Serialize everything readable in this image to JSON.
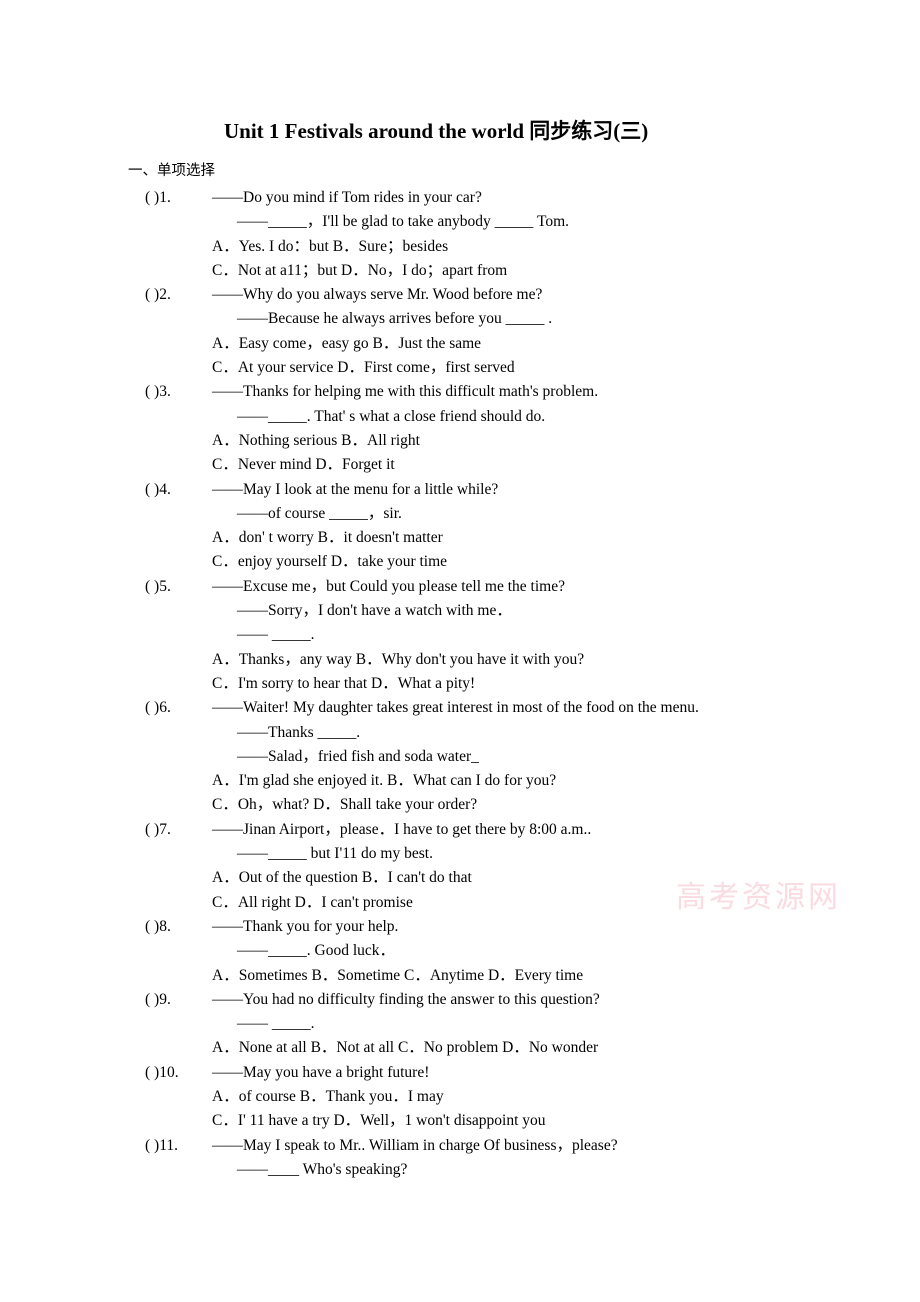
{
  "document": {
    "title": "Unit 1 Festivals around the world  同步练习(三)",
    "section_heading": "一、单项选择",
    "watermark": "高考资源网"
  },
  "questions": [
    {
      "marker": "(        )1.",
      "lines": [
        "——Do you mind if Tom rides in your car?",
        "——_____，I'll be glad to take anybody _____ Tom."
      ],
      "options": [
        "A．Yes. I do：but       B．Sure；besides",
        "C．Not at a11；but      D．No，I do；apart from"
      ]
    },
    {
      "marker": "(        )2.",
      "lines": [
        "——Why do you always serve Mr. Wood before me?",
        "——Because he always arrives before you _____ ."
      ],
      "options": [
        "A．Easy come，easy go      B．Just the same",
        "C．At your service     D．First come，first served"
      ]
    },
    {
      "marker": "(        )3.",
      "lines": [
        "——Thanks for helping me with this difficult math's problem.",
        "——_____. That' s what a close friend should do."
      ],
      "options": [
        "A．Nothing serious      B．All right",
        "C．Never mind     D．Forget it"
      ]
    },
    {
      "marker": "(        )4.",
      "lines": [
        "——May I look at the menu for a little while?",
        "——of course _____，sir."
      ],
      "options": [
        "A．don' t worry      B．it doesn't matter",
        "C．enjoy yourself     D．take your time"
      ]
    },
    {
      "marker": "(        )5.",
      "lines": [
        "——Excuse me，but Could you please tell me the time?",
        "——Sorry，I don't have a watch with me．",
        "—— _____."
      ],
      "options": [
        "A．Thanks，any way      B．Why don't you have it with you?",
        "C．I'm sorry to hear that     D．What a pity!"
      ]
    },
    {
      "marker": "(        )6.",
      "lines": [
        "——Waiter! My daughter takes great interest in most of the food on the menu.",
        "——Thanks _____.",
        "——Salad，fried fish and soda water_"
      ],
      "options": [
        "A．I'm glad she enjoyed it.        B．What can I do for you?",
        "C．Oh，what?     D．Shall take your order?"
      ]
    },
    {
      "marker": "(        )7.",
      "lines": [
        "——Jinan Airport，please．I have to get there by 8:00 a.m..",
        "——_____  but I'11 do my best."
      ],
      "options": [
        "A．Out of the question      B．I can't do that",
        "C．All right      D．I can't promise"
      ]
    },
    {
      "marker": "(        )8.",
      "lines": [
        "——Thank you for your help.",
        "——_____. Good luck．"
      ],
      "options": [
        "A．Sometimes   B．Sometime    C．Anytime    D．Every time"
      ]
    },
    {
      "marker": "(        )9.",
      "lines": [
        "——You had no difficulty finding the answer to this question?",
        "—— _____."
      ],
      "options": [
        "A．None at all    B．Not at all     C．No problem     D．No wonder"
      ]
    },
    {
      "marker": "(        )10.",
      "lines": [
        "——May you have a bright future!"
      ],
      "options": [
        "A．of course     B．Thank you．I may",
        "C．I' 11 have a try     D．Well，1 won't disappoint you"
      ]
    },
    {
      "marker": "(        )11.",
      "lines": [
        "——May I speak to Mr.. William in charge Of business，please?",
        "——____   Who's speaking?"
      ],
      "options": []
    }
  ]
}
